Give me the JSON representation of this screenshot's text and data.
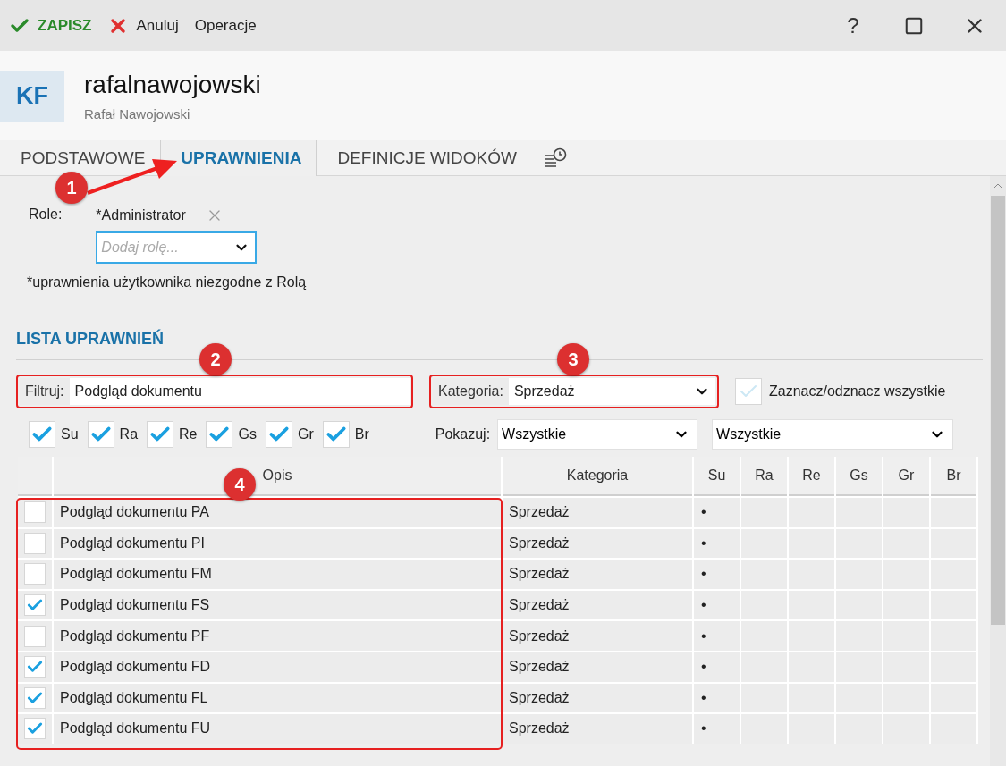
{
  "toolbar": [
    {
      "kind": "save",
      "label": "ZAPISZ"
    },
    {
      "kind": "cancel",
      "label": "Anuluj"
    },
    {
      "kind": "menu",
      "label": "Operacje"
    }
  ],
  "window_controls": {
    "help": "?"
  },
  "header": {
    "avatar": "KF",
    "title": "rafalnawojowski",
    "subtitle": "Rafał Nawojowski"
  },
  "tabs": [
    {
      "label": "PODSTAWOWE",
      "selected": false
    },
    {
      "label": "UPRAWNIENIA",
      "selected": true
    },
    {
      "label": "DEFINICJE WIDOKÓW",
      "selected": false
    }
  ],
  "roles": {
    "label": "Role:",
    "assigned": [
      "*Administrator"
    ],
    "placeholder": "Dodaj rolę...",
    "note": "*uprawnienia użytkownika niezgodne z Rolą"
  },
  "permissions": {
    "title": "LISTA UPRAWNIEŃ",
    "filter": {
      "label": "Filtruj:",
      "value": "Podgląd dokumentu"
    },
    "category": {
      "label": "Kategoria:",
      "value": "Sprzedaż"
    },
    "select_all": {
      "label": "Zaznacz/odznacz wszystkie",
      "checked": false
    },
    "column_toggles": [
      {
        "label": "Su",
        "checked": true
      },
      {
        "label": "Ra",
        "checked": true
      },
      {
        "label": "Re",
        "checked": true
      },
      {
        "label": "Gs",
        "checked": true
      },
      {
        "label": "Gr",
        "checked": true
      },
      {
        "label": "Br",
        "checked": true
      }
    ],
    "show": {
      "label": "Pokazuj:",
      "values": [
        "Wszystkie",
        "Wszystkie"
      ]
    },
    "table": {
      "columns": [
        "Opis",
        "Kategoria",
        "Su",
        "Ra",
        "Re",
        "Gs",
        "Gr",
        "Br"
      ],
      "rows": [
        {
          "checked": false,
          "description": "Podgląd dokumentu PA",
          "category": "Sprzedaż",
          "values": [
            "•"
          ]
        },
        {
          "checked": false,
          "description": "Podgląd dokumentu PI",
          "category": "Sprzedaż",
          "values": [
            "•"
          ]
        },
        {
          "checked": false,
          "description": "Podgląd dokumentu FM",
          "category": "Sprzedaż",
          "values": [
            "•"
          ]
        },
        {
          "checked": true,
          "description": "Podgląd dokumentu FS",
          "category": "Sprzedaż",
          "values": [
            "•"
          ]
        },
        {
          "checked": false,
          "description": "Podgląd dokumentu PF",
          "category": "Sprzedaż",
          "values": [
            "•"
          ]
        },
        {
          "checked": true,
          "description": "Podgląd dokumentu FD",
          "category": "Sprzedaż",
          "values": [
            "•"
          ]
        },
        {
          "checked": true,
          "description": "Podgląd dokumentu FL",
          "category": "Sprzedaż",
          "values": [
            "•"
          ]
        },
        {
          "checked": true,
          "description": "Podgląd dokumentu FU",
          "category": "Sprzedaż",
          "values": [
            "•"
          ]
        }
      ]
    }
  },
  "annotations": [
    {
      "label": "1"
    },
    {
      "label": "2"
    },
    {
      "label": "3"
    },
    {
      "label": "4"
    }
  ]
}
